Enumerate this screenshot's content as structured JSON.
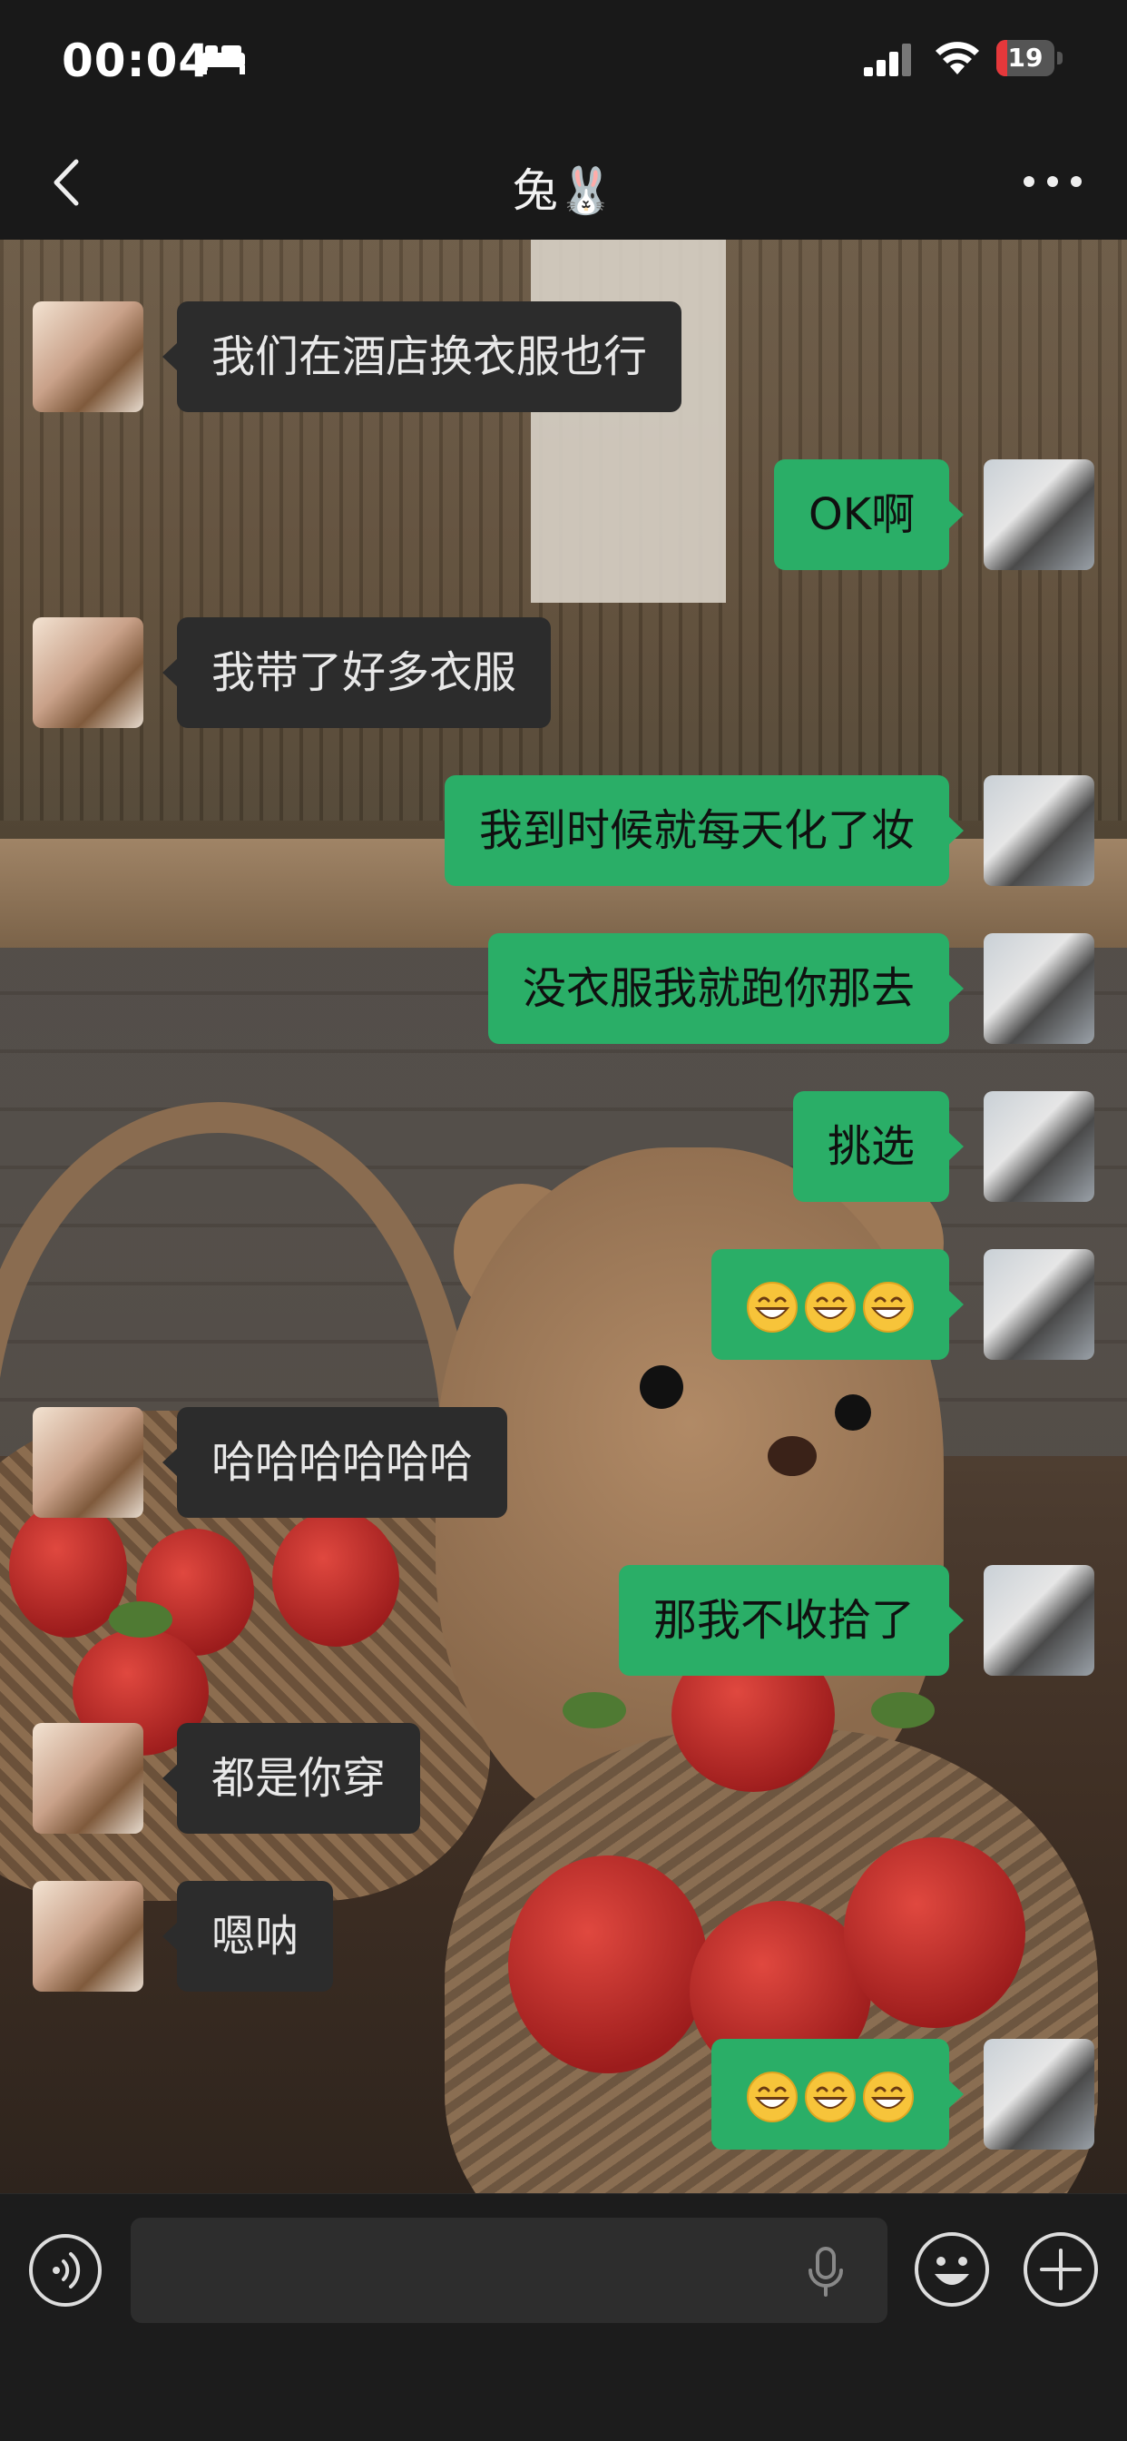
{
  "status_bar": {
    "time": "00:04",
    "battery_text": "19",
    "battery_level": 0.19,
    "battery_color": "#e5383b"
  },
  "chat_header": {
    "title": "兔🐰"
  },
  "messages": [
    {
      "side": "in",
      "text": "我们在酒店换衣服也行"
    },
    {
      "side": "out",
      "text": "OK啊"
    },
    {
      "side": "in",
      "text": "我带了好多衣服"
    },
    {
      "side": "out",
      "text": "我到时候就每天化了妆"
    },
    {
      "side": "out",
      "text": "没衣服我就跑你那去"
    },
    {
      "side": "out",
      "text": "挑选"
    },
    {
      "side": "out",
      "emoji": "grin-icon",
      "emoji_count": 3
    },
    {
      "side": "in",
      "text": "哈哈哈哈哈哈"
    },
    {
      "side": "out",
      "text": "那我不收拾了"
    },
    {
      "side": "in",
      "text": "都是你穿"
    },
    {
      "side": "in",
      "text": "嗯呐"
    },
    {
      "side": "out",
      "emoji": "grin-icon",
      "emoji_count": 3
    }
  ],
  "input_bar": {
    "voice_icon": "voice-icon",
    "mic_icon": "mic-icon",
    "emoji_icon": "smiley-icon",
    "plus_icon": "plus-icon"
  },
  "colors": {
    "out_bubble": "#2aae67",
    "in_bubble": "#2c2c2c",
    "header_bg": "#191919"
  }
}
